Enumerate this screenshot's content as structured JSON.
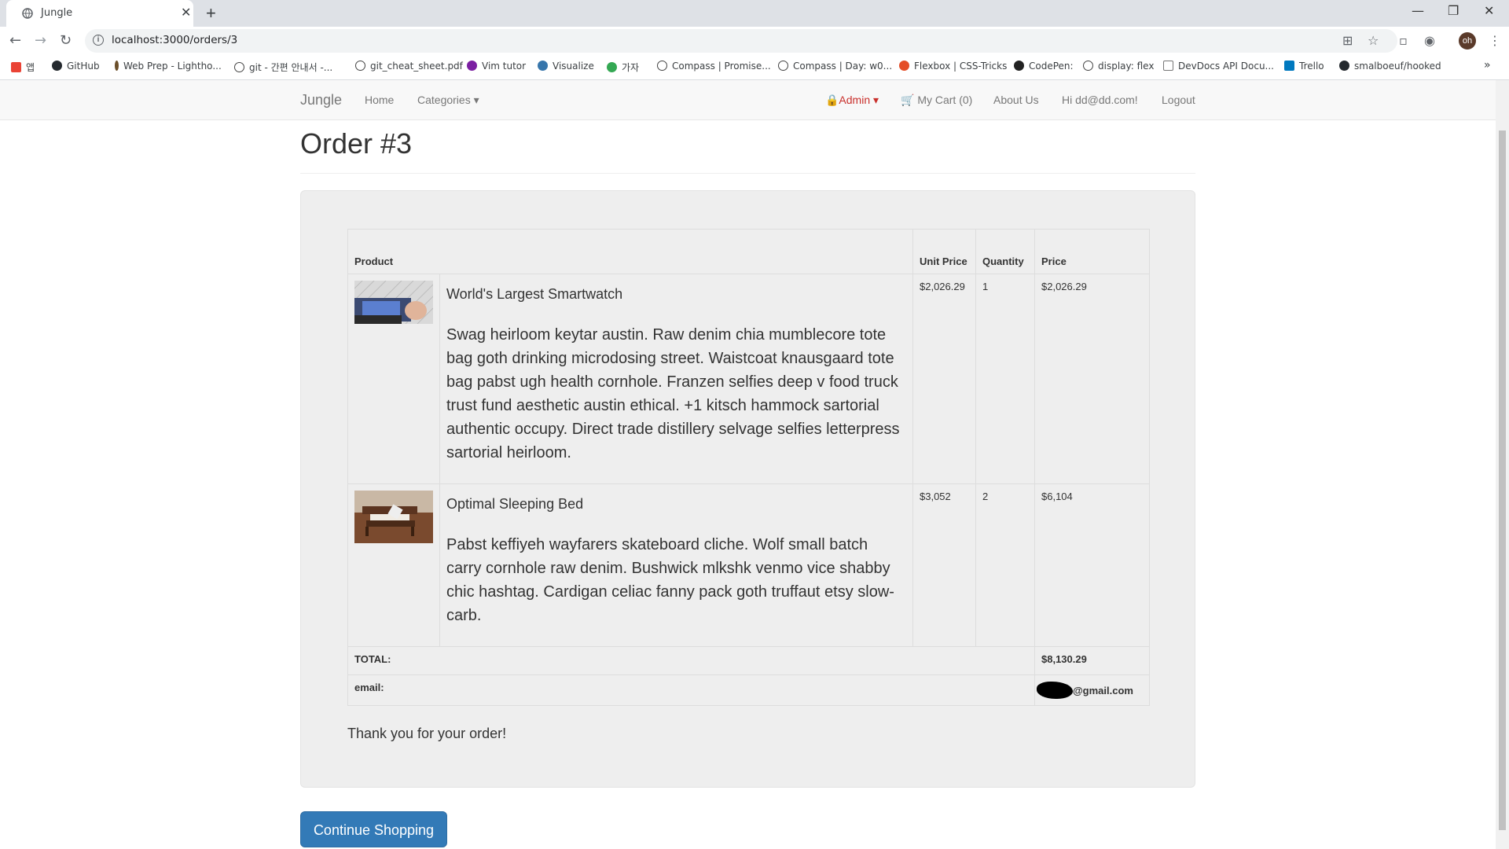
{
  "browser": {
    "tab_title": "Jungle",
    "tab_close": "✕",
    "new_tab": "+",
    "url": "localhost:3000/orders/3",
    "profile_initials": "oh",
    "window_controls": {
      "minimize": "—",
      "restore": "❐",
      "close": "✕"
    },
    "bookmarks": [
      {
        "label": "앱",
        "color": "#ea4335"
      },
      {
        "label": "GitHub",
        "color": "#24292e"
      },
      {
        "label": "Web Prep - Lightho...",
        "color": "#6b4f2a"
      },
      {
        "label": "git - 간편 안내서 -...",
        "color": "#444444"
      },
      {
        "label": "git_cheat_sheet.pdf",
        "color": "#444444"
      },
      {
        "label": "Vim tutor",
        "color": "#7b1fa2"
      },
      {
        "label": "Visualize",
        "color": "#3776ab"
      },
      {
        "label": "가자",
        "color": "#34a853"
      },
      {
        "label": "Compass | Promise...",
        "color": "#444444"
      },
      {
        "label": "Compass | Day: w0...",
        "color": "#444444"
      },
      {
        "label": "Flexbox | CSS-Tricks",
        "color": "#e44d26"
      },
      {
        "label": "CodePen:",
        "color": "#222222"
      },
      {
        "label": "display: flex",
        "color": "#444444"
      },
      {
        "label": "DevDocs API Docu...",
        "color": "#777777"
      },
      {
        "label": "Trello",
        "color": "#0079bf"
      },
      {
        "label": "smalboeuf/hooked",
        "color": "#24292e"
      }
    ],
    "bookmarks_more": "»"
  },
  "nav": {
    "brand": "Jungle",
    "home": "Home",
    "categories": "Categories ▾",
    "admin": "🔒Admin ▾",
    "cart": "🛒 My Cart (0)",
    "about": "About Us",
    "greeting": "Hi dd@dd.com!",
    "logout": "Logout"
  },
  "order": {
    "title": "Order #3",
    "headers": {
      "product": "Product",
      "unit_price": "Unit Price",
      "quantity": "Quantity",
      "price": "Price"
    },
    "items": [
      {
        "name": "World's Largest Smartwatch",
        "description": "Swag heirloom keytar austin. Raw denim chia mumblecore tote bag goth drinking microdosing street. Waistcoat knausgaard tote bag pabst ugh health cornhole. Franzen selfies deep v food truck trust fund aesthetic austin ethical. +1 kitsch hammock sartorial authentic occupy. Direct trade distillery selvage selfies letterpress sartorial heirloom.",
        "unit_price": "$2,026.29",
        "quantity": "1",
        "price": "$2,026.29"
      },
      {
        "name": "Optimal Sleeping Bed",
        "description": "Pabst keffiyeh wayfarers skateboard cliche. Wolf small batch carry cornhole raw denim. Bushwick mlkshk venmo vice shabby chic hashtag. Cardigan celiac fanny pack goth truffaut etsy slow-carb.",
        "unit_price": "$3,052",
        "quantity": "2",
        "price": "$6,104"
      }
    ],
    "total_label": "TOTAL:",
    "total_value": "$8,130.29",
    "email_label": "email:",
    "email_domain": "@gmail.com",
    "thanks": "Thank you for your order!",
    "continue_label": "Continue Shopping"
  }
}
